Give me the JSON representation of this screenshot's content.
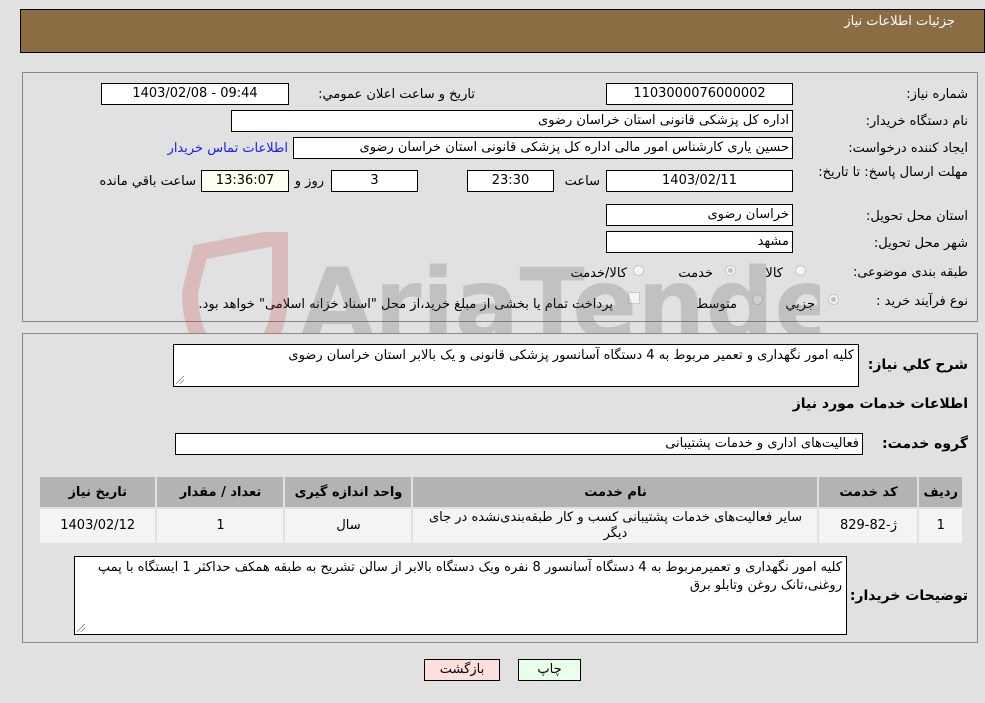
{
  "header": {
    "title": "جزئیات اطلاعات نیاز"
  },
  "form": {
    "need_number": {
      "label": "شماره نیاز:",
      "value": "1103000076000002"
    },
    "announce_datetime": {
      "label": "تاریخ و ساعت اعلان عمومي:",
      "value": "1403/02/08 - 09:44"
    },
    "buyer_org": {
      "label": "نام دستگاه خریدار:",
      "value": "اداره کل پزشکی قانونی استان خراسان رضوی"
    },
    "requester": {
      "label": "ایجاد کننده درخواست:",
      "value": "حسین یاری کارشناس امور مالی اداره کل پزشکی قانونی استان خراسان رضوی",
      "contact_link": "اطلاعات تماس خریدار"
    },
    "deadline": {
      "label": "مهلت ارسال پاسخ: تا تاریخ:",
      "date": "1403/02/11",
      "time_label": "ساعت",
      "time": "23:30",
      "days": "3",
      "days_label": "روز و",
      "remaining": "13:36:07",
      "remaining_label": "ساعت باقي مانده"
    },
    "delivery_province": {
      "label": "استان محل تحویل:",
      "value": "خراسان رضوی"
    },
    "delivery_city": {
      "label": "شهر محل تحویل:",
      "value": "مشهد"
    },
    "category": {
      "label": "طبقه بندی موضوعی:",
      "options": [
        "کالا",
        "خدمت",
        "کالا/خدمت"
      ],
      "selected": "خدمت"
    },
    "purchase_type": {
      "label": "نوع فرآیند خرید :",
      "options": [
        "جزيي",
        "متوسط"
      ],
      "selected": "جزيي",
      "treasury_note": "پرداخت تمام یا بخشی از مبلغ خرید،از محل \"اسناد خزانه اسلامی\" خواهد بود."
    }
  },
  "details": {
    "description_label": "شرح کلي نیاز:",
    "description": "کلیه امور نگهداری و تعمیر مربوط به 4 دستگاه آسانسور پزشکی قانونی و یک بالابر استان خراسان رضوی",
    "services_heading": "اطلاعات خدمات مورد نیاز",
    "service_group_label": "گروه خدمت:",
    "service_group": "فعالیت‌های اداری و خدمات پشتیبانی",
    "table": {
      "headers": [
        "ردیف",
        "کد خدمت",
        "نام خدمت",
        "واحد اندازه گیری",
        "تعداد / مقدار",
        "تاریخ نیاز"
      ],
      "rows": [
        [
          "1",
          "ژ-82-829",
          "سایر فعالیت‌های خدمات پشتیبانی کسب و کار طبقه‌بندی‌نشده در جای دیگر",
          "سال",
          "1",
          "1403/02/12"
        ]
      ]
    },
    "buyer_notes_label": "توضیحات خریدار:",
    "buyer_notes": "کلیه امور نگهداری و تعمیرمربوط به 4 دستگاه آسانسور 8 نفره  ویک دستگاه بالابر از سالن تشریح به طبقه همکف حداکثر 1 ایستگاه با پمپ روغنی،تانک روغن وتابلو برق"
  },
  "buttons": {
    "print": "چاپ",
    "back": "بازگشت"
  },
  "watermark": {
    "text": "AriaTender.neT"
  },
  "colors": {
    "header_bg": "#8b6d43",
    "link": "#1a1aff",
    "back_btn": "#ffdede",
    "print_btn": "#eaffea",
    "remaining_bg": "#fffff0"
  }
}
